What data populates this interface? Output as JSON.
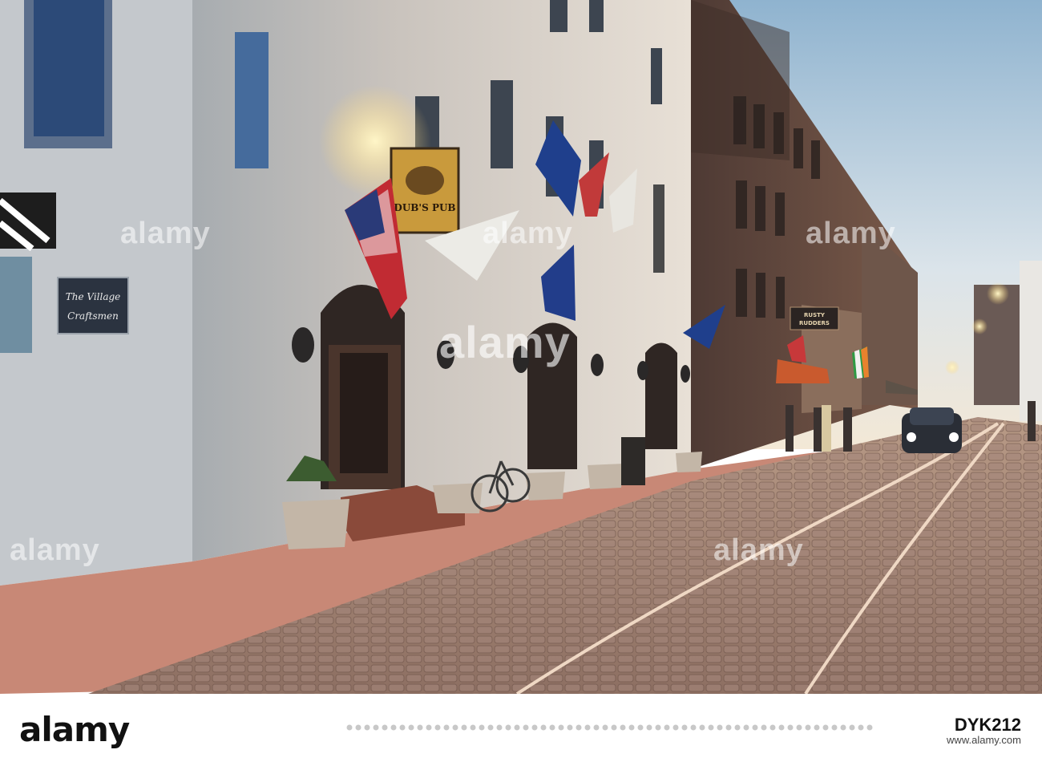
{
  "photo": {
    "description_colors": {
      "sky": "#dce6ee",
      "cobble": "#9a7a6c",
      "wall": "#d8d0c8",
      "brick": "#5a4038"
    },
    "signs": {
      "village": "The Village\nCraftsmen",
      "pub_sign": "DUB'S PUB",
      "rusty": "RUSTY\nRUDDERS"
    },
    "watermark": "alamy"
  },
  "footer": {
    "logo": "alamy",
    "image_id": "DYK212",
    "site": "www.alamy.com"
  }
}
